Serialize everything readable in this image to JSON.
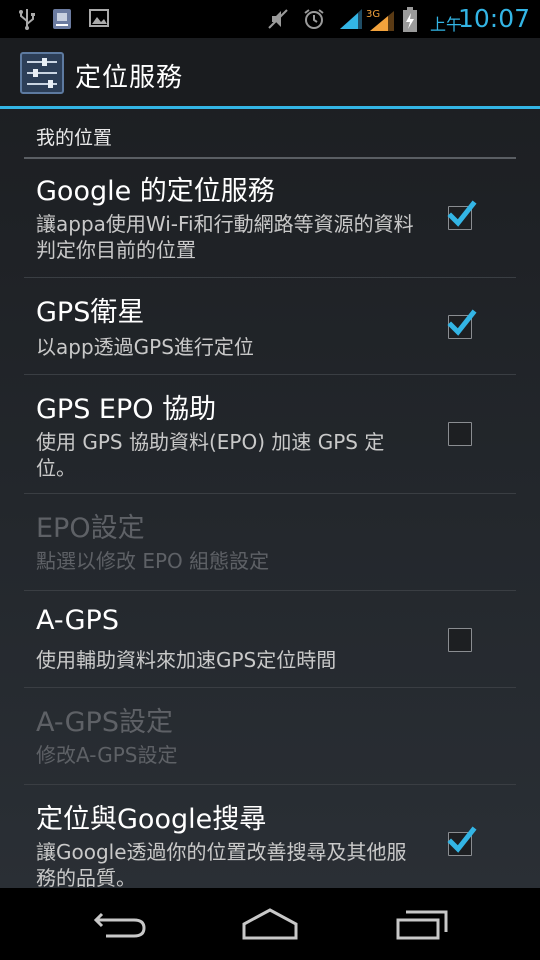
{
  "status_bar": {
    "ampm": "上午",
    "time": "10:07",
    "network_type": "3G",
    "icons": [
      "usb-icon",
      "sim-toolkit-icon",
      "image-icon",
      "mute-icon",
      "alarm-icon",
      "wifi-signal-icon",
      "signal-3g-icon",
      "battery-charging-icon"
    ]
  },
  "action_bar": {
    "title": "定位服務",
    "icon": "settings-sliders-icon"
  },
  "category": {
    "label": "我的位置"
  },
  "prefs": [
    {
      "title": "Google 的定位服務",
      "summary": "讓appa使用Wi-Fi和行動網路等資源的資料判定你目前的位置",
      "checked": true,
      "enabled": true
    },
    {
      "title": "GPS衛星",
      "summary": "以app透過GPS進行定位",
      "checked": true,
      "enabled": true
    },
    {
      "title": "GPS EPO 協助",
      "summary": "使用 GPS 協助資料(EPO) 加速 GPS 定位。",
      "checked": false,
      "enabled": true
    },
    {
      "title": "EPO設定",
      "summary": "點選以修改 EPO 組態設定",
      "enabled": false
    },
    {
      "title": "A-GPS",
      "summary": "使用輔助資料來加速GPS定位時間",
      "checked": false,
      "enabled": true
    },
    {
      "title": "A-GPS設定",
      "summary": "修改A-GPS設定",
      "enabled": false
    },
    {
      "title": "定位與Google搜尋",
      "summary": "讓Google透過你的位置改善搜尋及其他服務的品質。",
      "checked": true,
      "enabled": true
    }
  ],
  "nav_bar": {
    "buttons": [
      "back-icon",
      "home-icon",
      "recent-apps-icon"
    ]
  },
  "colors": {
    "accent": "#33b5e5",
    "background": "#23272c",
    "text_primary": "#ffffff",
    "text_disabled": "#5e6166"
  }
}
